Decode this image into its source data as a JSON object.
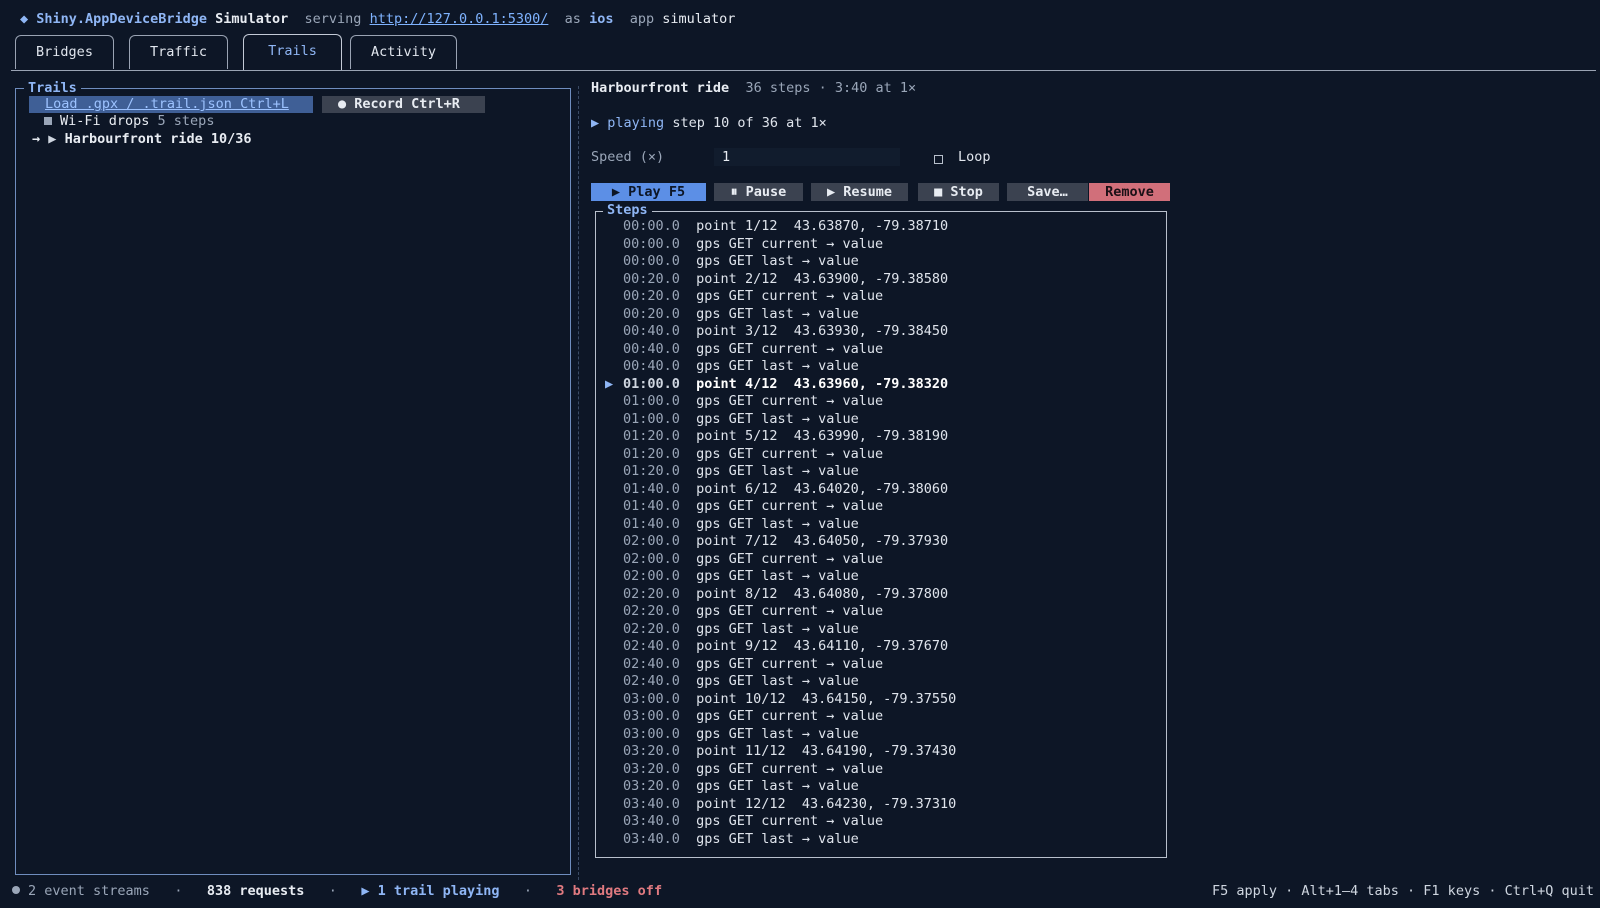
{
  "header": {
    "diamond": "◆",
    "brand": "Shiny.AppDeviceBridge",
    "app": "Simulator",
    "serving_label": "serving",
    "url": "http://127.0.0.1:5300/",
    "as_label": "as",
    "platform": "ios",
    "app_label": "app",
    "app_name": "simulator"
  },
  "tabs": [
    {
      "label": "Bridges"
    },
    {
      "label": "Traffic"
    },
    {
      "label": "Trails",
      "active": true
    },
    {
      "label": "Activity"
    }
  ],
  "trails_panel": {
    "title": "Trails",
    "load_button": "Load .gpx / .trail.json  Ctrl+L",
    "record_button": "● Record  Ctrl+R",
    "items": [
      {
        "name": "Wi-Fi drops",
        "detail": "5 steps",
        "selected": false,
        "playing": false
      },
      {
        "name": "Harbourfront ride",
        "detail": "10/36",
        "selected": true,
        "playing": true,
        "marker": "→",
        "play_glyph": "▶"
      }
    ]
  },
  "detail": {
    "title": "Harbourfront ride",
    "meta": "36 steps · 3:40 at 1×",
    "status_glyph": "▶",
    "status_word": "playing",
    "status_text": "step 10 of 36 at 1×",
    "speed_label": "Speed (×)",
    "speed_value": "1",
    "loop_label": "Loop",
    "loop_checked": false,
    "buttons": {
      "play": "▶ Play  F5",
      "pause": "⏸ Pause",
      "resume": "▶ Resume",
      "stop": "■ Stop",
      "save": "Save…",
      "remove": "Remove"
    },
    "steps_title": "Steps",
    "steps": [
      {
        "time": "00:00.0",
        "text": "point 1/12  43.63870, -79.38710"
      },
      {
        "time": "00:00.0",
        "text": "gps GET current → value"
      },
      {
        "time": "00:00.0",
        "text": "gps GET last → value"
      },
      {
        "time": "00:20.0",
        "text": "point 2/12  43.63900, -79.38580"
      },
      {
        "time": "00:20.0",
        "text": "gps GET current → value"
      },
      {
        "time": "00:20.0",
        "text": "gps GET last → value"
      },
      {
        "time": "00:40.0",
        "text": "point 3/12  43.63930, -79.38450"
      },
      {
        "time": "00:40.0",
        "text": "gps GET current → value"
      },
      {
        "time": "00:40.0",
        "text": "gps GET last → value"
      },
      {
        "time": "01:00.0",
        "text": "point 4/12  43.63960, -79.38320",
        "current": true,
        "marker": "▶"
      },
      {
        "time": "01:00.0",
        "text": "gps GET current → value"
      },
      {
        "time": "01:00.0",
        "text": "gps GET last → value"
      },
      {
        "time": "01:20.0",
        "text": "point 5/12  43.63990, -79.38190"
      },
      {
        "time": "01:20.0",
        "text": "gps GET current → value"
      },
      {
        "time": "01:20.0",
        "text": "gps GET last → value"
      },
      {
        "time": "01:40.0",
        "text": "point 6/12  43.64020, -79.38060"
      },
      {
        "time": "01:40.0",
        "text": "gps GET current → value"
      },
      {
        "time": "01:40.0",
        "text": "gps GET last → value"
      },
      {
        "time": "02:00.0",
        "text": "point 7/12  43.64050, -79.37930"
      },
      {
        "time": "02:00.0",
        "text": "gps GET current → value"
      },
      {
        "time": "02:00.0",
        "text": "gps GET last → value"
      },
      {
        "time": "02:20.0",
        "text": "point 8/12  43.64080, -79.37800"
      },
      {
        "time": "02:20.0",
        "text": "gps GET current → value"
      },
      {
        "time": "02:20.0",
        "text": "gps GET last → value"
      },
      {
        "time": "02:40.0",
        "text": "point 9/12  43.64110, -79.37670"
      },
      {
        "time": "02:40.0",
        "text": "gps GET current → value"
      },
      {
        "time": "02:40.0",
        "text": "gps GET last → value"
      },
      {
        "time": "03:00.0",
        "text": "point 10/12  43.64150, -79.37550"
      },
      {
        "time": "03:00.0",
        "text": "gps GET current → value"
      },
      {
        "time": "03:00.0",
        "text": "gps GET last → value"
      },
      {
        "time": "03:20.0",
        "text": "point 11/12  43.64190, -79.37430"
      },
      {
        "time": "03:20.0",
        "text": "gps GET current → value"
      },
      {
        "time": "03:20.0",
        "text": "gps GET last → value"
      },
      {
        "time": "03:40.0",
        "text": "point 12/12  43.64230, -79.37310"
      },
      {
        "time": "03:40.0",
        "text": "gps GET current → value"
      },
      {
        "time": "03:40.0",
        "text": "gps GET last → value"
      }
    ]
  },
  "footer": {
    "streams": "2 event streams",
    "sep": "·",
    "requests": "838 requests",
    "trail_playing": "▶ 1 trail playing",
    "bridges_off": "3 bridges off",
    "hints": "F5 apply · Alt+1–4 tabs · F1 keys · Ctrl+Q quit"
  }
}
